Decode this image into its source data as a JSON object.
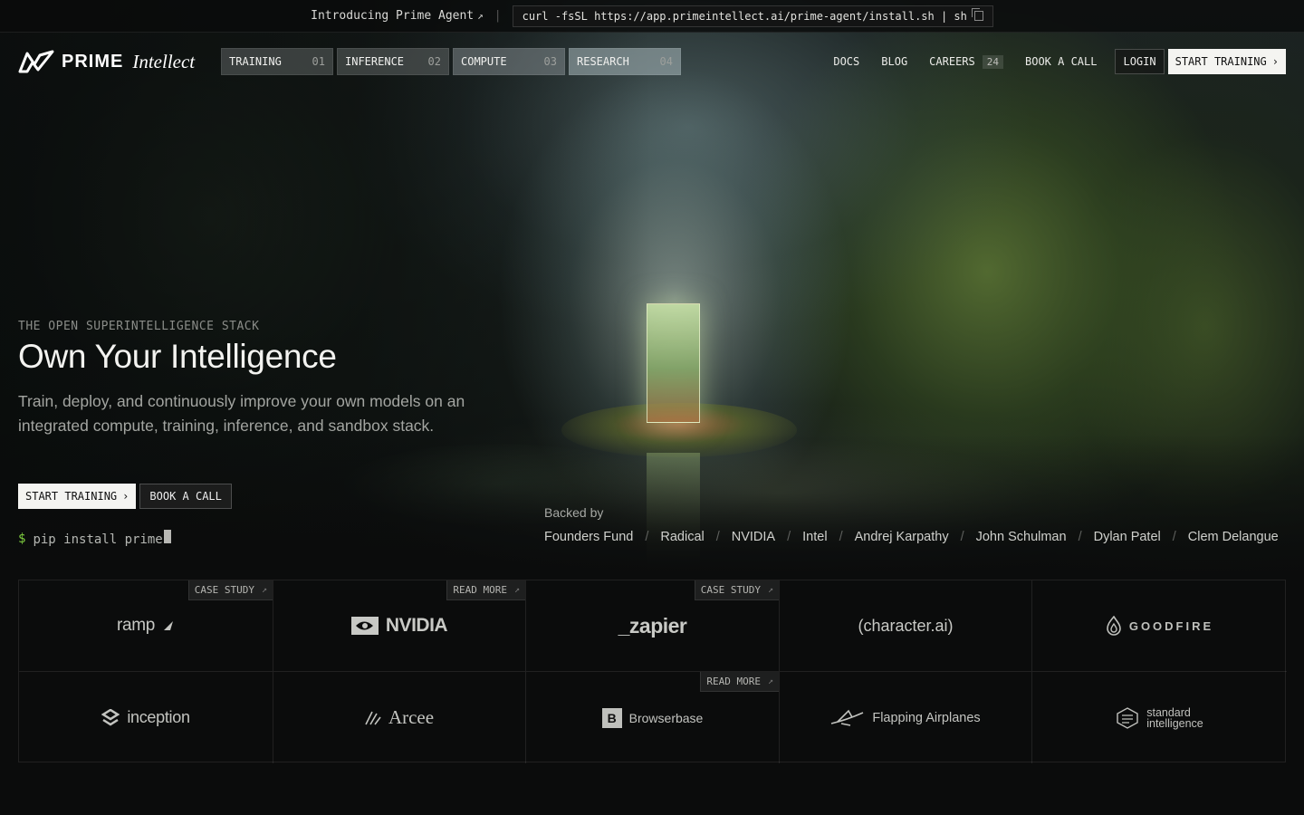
{
  "announcement": {
    "intro_label": "Introducing Prime Agent",
    "intro_icon": "arrow-up-right-icon",
    "install_command": "curl -fsSL https://app.primeintellect.ai/prime-agent/install.sh | sh",
    "copy_icon": "copy-icon"
  },
  "nav": {
    "logo": {
      "word1": "PRIME",
      "word2": "Intellect",
      "icon": "prime-intellect-logo-icon"
    },
    "product_tabs": [
      {
        "label": "TRAINING",
        "num": "01"
      },
      {
        "label": "INFERENCE",
        "num": "02"
      },
      {
        "label": "COMPUTE",
        "num": "03"
      },
      {
        "label": "RESEARCH",
        "num": "04"
      }
    ],
    "links": {
      "docs": "DOCS",
      "blog": "BLOG",
      "careers": "CAREERS",
      "careers_count": "24",
      "book_call": "BOOK A CALL",
      "login": "LOGIN",
      "start_training": "START TRAINING",
      "start_icon": "chevron-right-icon"
    }
  },
  "hero": {
    "eyebrow": "THE OPEN SUPERINTELLIGENCE STACK",
    "headline": "Own Your Intelligence",
    "subhead": "Train, deploy, and continuously improve your own models on an integrated compute, training, inference, and sandbox stack.",
    "cta_primary": "START TRAINING",
    "cta_secondary": "BOOK A CALL",
    "pip_prompt": "$",
    "pip_command": "pip install prime"
  },
  "backed_by": {
    "label": "Backed by",
    "backers": [
      "Founders Fund",
      "Radical",
      "NVIDIA",
      "Intel",
      "Andrej Karpathy",
      "John Schulman",
      "Dylan Patel",
      "Clem Delangue"
    ],
    "separator": "/"
  },
  "logo_grid": {
    "cells": [
      {
        "brand": "ramp",
        "tag": "CASE STUDY"
      },
      {
        "brand": "NVIDIA",
        "tag": "READ MORE"
      },
      {
        "brand": "_zapier",
        "tag": "CASE STUDY"
      },
      {
        "brand": "(character.ai)",
        "tag": ""
      },
      {
        "brand": "GOODFIRE",
        "tag": ""
      },
      {
        "brand": "inception",
        "tag": ""
      },
      {
        "brand": "Arcee",
        "tag": ""
      },
      {
        "brand": "Browserbase",
        "tag": "READ MORE"
      },
      {
        "brand": "Flapping Airplanes",
        "tag": ""
      },
      {
        "brand_line1": "standard",
        "brand_line2": "intelligence",
        "tag": ""
      }
    ],
    "tag_icon": "arrow-up-right-icon"
  },
  "colors": {
    "background": "#0b0c0c",
    "primary_button": "#f4f4f1",
    "prompt_green": "#7fcf3f",
    "muted_text": "#a3a5a1"
  }
}
